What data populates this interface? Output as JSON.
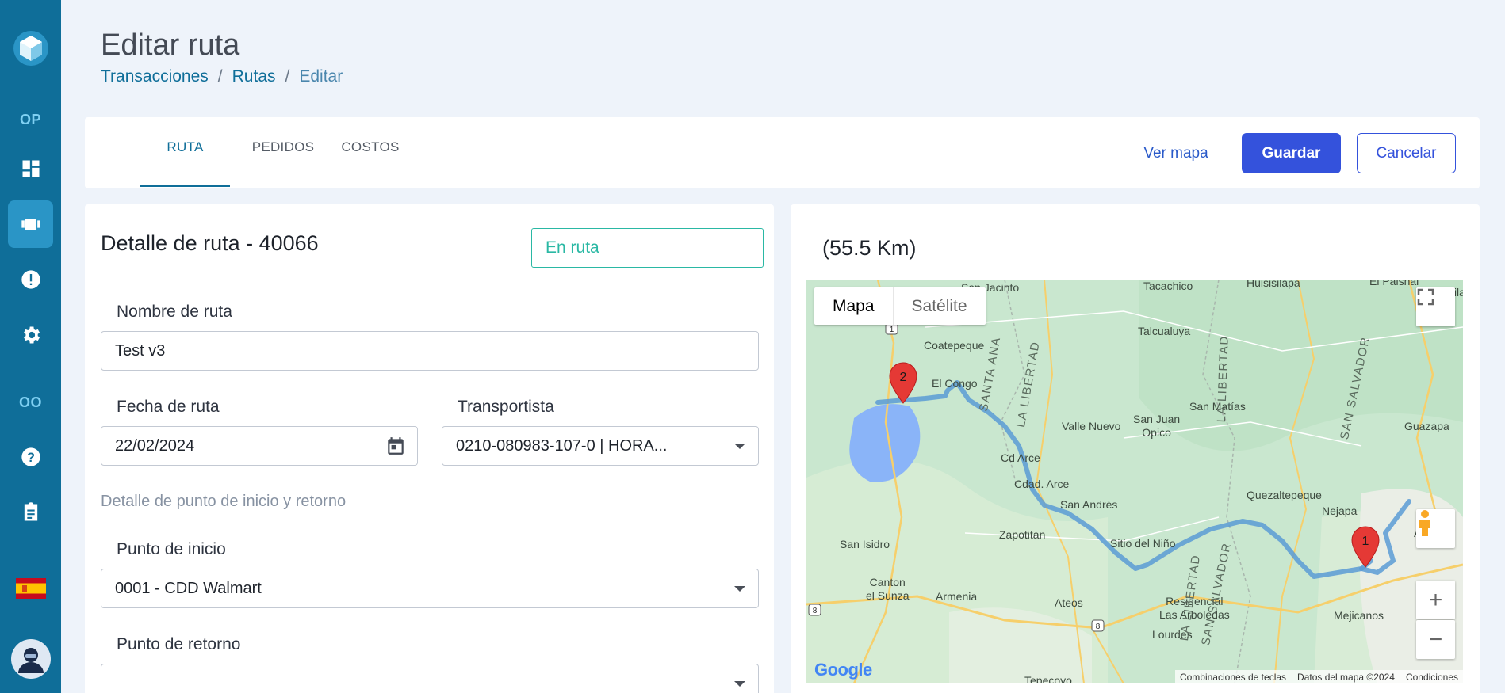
{
  "sidebar": {
    "op_label": "OP",
    "oo_label": "OO",
    "items": [
      {
        "icon": "dashboard-icon"
      },
      {
        "icon": "truck-icon"
      },
      {
        "icon": "alert-icon"
      },
      {
        "icon": "gear-icon"
      },
      {
        "icon": "help-icon"
      },
      {
        "icon": "clipboard-icon"
      },
      {
        "icon": "spain-flag-icon"
      },
      {
        "icon": "user-avatar-icon"
      }
    ]
  },
  "header": {
    "title": "Editar ruta",
    "breadcrumb": [
      "Transacciones",
      "/",
      "Rutas",
      "/",
      "Editar"
    ]
  },
  "tabs": [
    "RUTA",
    "PEDIDOS",
    "COSTOS"
  ],
  "actions": {
    "view_map": "Ver mapa",
    "save": "Guardar",
    "cancel": "Cancelar"
  },
  "detail": {
    "title": "Detalle de ruta - 40066",
    "status": "En ruta",
    "name_label": "Nombre de ruta",
    "name_value": "Test v3",
    "date_label": "Fecha de ruta",
    "date_value": "22/02/2024",
    "carrier_label": "Transportista",
    "carrier_value": "0210-080983-107-0 | HORA...",
    "section_label": "Detalle de punto de inicio y retorno",
    "start_label": "Punto de inicio",
    "start_value": "0001 - CDD Walmart",
    "return_label": "Punto de retorno",
    "return_value": ""
  },
  "map": {
    "distance": "(55.5 Km)",
    "map_type_map": "Mapa",
    "map_type_satellite": "Satélite",
    "zoom_in": "+",
    "zoom_out": "−",
    "footer": [
      "Combinaciones de teclas",
      "Datos del mapa ©2024",
      "Condiciones"
    ],
    "google": "Google",
    "marker_1": "1",
    "marker_2": "2",
    "places": {
      "san_jacinto": "San Jacinto",
      "tacachico": "Tacachico",
      "huisisilapa": "Huisisilapa",
      "el_paisnal": "El Paisnal",
      "aguila": "Aguila",
      "coatepeque": "Coatepeque",
      "talcualuya": "Talcualuya",
      "el_congo": "El Congo",
      "valle_nuevo": "Valle Nuevo",
      "san_juan_opico": "San Juan\nOpico",
      "san_matias": "San Matías",
      "guazapa": "Guazapa",
      "cd_arce": "Cd Arce",
      "cdad_arce": "Cdad. Arce",
      "quezaltepeque": "Quezaltepeque",
      "nejapa": "Nejapa",
      "san_andres": "San Andrés",
      "zapotitan": "Zapotitan",
      "sitio_del_nino": "Sitio del Niño",
      "san_isidro": "San Isidro",
      "canton_el_sunza": "Canton\nel Sunza",
      "armenia": "Armenia",
      "ateos": "Ateos",
      "residencial": "Residencial\nLas Arboledas",
      "lourdes": "Lourdes",
      "mejicanos": "Mejicanos",
      "tepecoyo": "Tepecoyo",
      "ap": "Ap",
      "santa_ana_rot": "SANTA ANA",
      "la_libertad_rot": "LA LIBERTAD",
      "la_libertad_rot2": "LA LIBERTAD",
      "san_salvador_rot": "SAN SALVADOR",
      "la_libertad_rot3": "LA LIBERTAD",
      "san_salvador_rot2": "SAN SALVADOR"
    },
    "route_shields": [
      "1",
      "8",
      "8"
    ]
  },
  "colors": {
    "sidebar": "#0f6e99",
    "primary": "#3452dc",
    "status": "#2ab8a4",
    "route": "#5b9bd5",
    "marker": "#e53935"
  }
}
